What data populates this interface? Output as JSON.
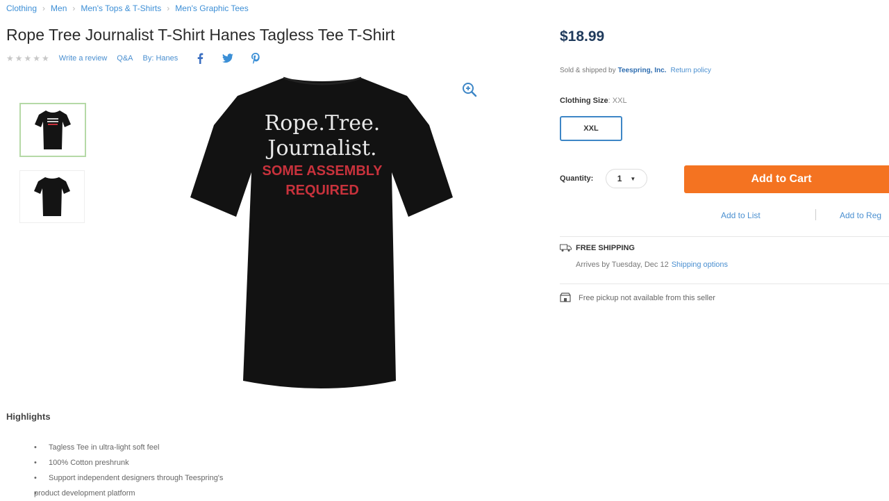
{
  "breadcrumb": [
    "Clothing",
    "Men",
    "Men's Tops & T-Shirts",
    "Men's Graphic Tees"
  ],
  "product": {
    "title": "Rope Tree Journalist T-Shirt Hanes Tagless Tee T-Shirt",
    "stars": "★★★★★",
    "write_review": "Write a review",
    "qa": "Q&A",
    "by": "By: Hanes",
    "shirt_print": {
      "line1": "Rope.Tree.",
      "line2": "Journalist.",
      "line3": "SOME ASSEMBLY",
      "line4": "REQUIRED"
    }
  },
  "social": {
    "facebook": "f",
    "twitter": "t",
    "pinterest": "p"
  },
  "highlights": {
    "title": "Highlights",
    "items": [
      "Tagless Tee in ultra-light soft feel",
      "100% Cotton preshrunk",
      "Support independent designers through Teespring's",
      "product development platform"
    ]
  },
  "buybox": {
    "price": "$18.99",
    "sold_by_prefix": "Sold & shipped by",
    "seller": "Teespring, Inc.",
    "return_policy": "Return policy",
    "size_label": "Clothing Size",
    "size_value": ": XXL",
    "size_option": "XXL",
    "quantity_label": "Quantity:",
    "quantity_value": "1",
    "add_to_cart": "Add to Cart",
    "add_to_list": "Add to List",
    "add_to_registry": "Add to Reg"
  },
  "shipping": {
    "title": "FREE SHIPPING",
    "arrives": "Arrives by Tuesday, Dec 12",
    "options_link": "Shipping options",
    "pickup": "Free pickup not available from this seller"
  },
  "colors": {
    "link": "#4a8fd0",
    "price": "#1f3a5c",
    "cart_button": "#f47321",
    "size_border": "#3d86c6",
    "shirt": "#111111",
    "print_red": "#c8323c"
  }
}
